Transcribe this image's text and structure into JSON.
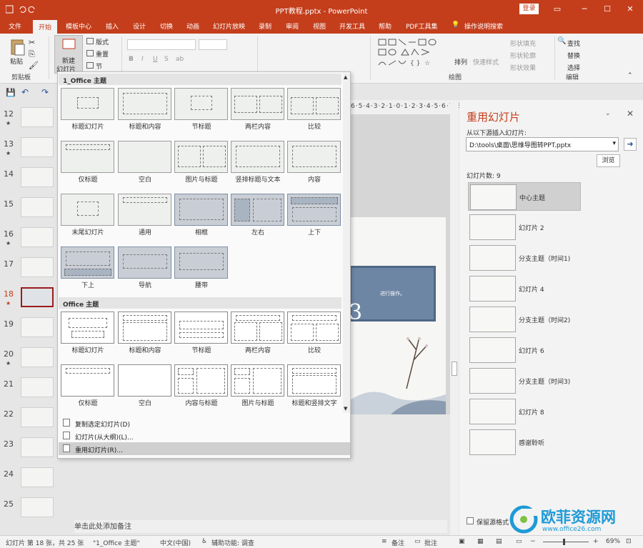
{
  "window": {
    "title": "PPT教程.pptx - PowerPoint",
    "login": "登录"
  },
  "tabs": [
    "文件",
    "开始",
    "模板中心",
    "插入",
    "设计",
    "切换",
    "动画",
    "幻灯片放映",
    "录制",
    "审阅",
    "视图",
    "开发工具",
    "帮助",
    "PDF工具集",
    "操作说明搜索"
  ],
  "ribbon": {
    "paste": "粘贴",
    "clipboard": "剪贴板",
    "new_slide_1": "新建",
    "new_slide_2": "幻灯片",
    "layout": "版式",
    "reset": "重置",
    "section": "节",
    "drawing": "绘图",
    "arrange": "排列",
    "quick_styles": "快速样式",
    "shape_fill": "形状填充",
    "shape_outline": "形状轮廓",
    "shape_effects": "形状效果",
    "find": "查找",
    "replace": "替换",
    "select": "选择",
    "editing": "编辑"
  },
  "slides": [
    {
      "num": "12",
      "star": "★"
    },
    {
      "num": "13",
      "star": "★"
    },
    {
      "num": "14",
      "star": ""
    },
    {
      "num": "15",
      "star": ""
    },
    {
      "num": "16",
      "star": "★"
    },
    {
      "num": "17",
      "star": ""
    },
    {
      "num": "18",
      "star": "★"
    },
    {
      "num": "19",
      "star": ""
    },
    {
      "num": "20",
      "star": "★"
    },
    {
      "num": "21",
      "star": ""
    },
    {
      "num": "22",
      "star": ""
    },
    {
      "num": "23",
      "star": ""
    },
    {
      "num": "24",
      "star": ""
    },
    {
      "num": "25",
      "star": ""
    }
  ],
  "layout_menu": {
    "section1": "1_Office 主题",
    "section1_layouts": [
      "标题幻灯片",
      "标题和内容",
      "节标题",
      "两栏内容",
      "比较",
      "仅标题",
      "空白",
      "图片与标题",
      "竖排标题与文本",
      "内容",
      "末尾幻灯片",
      "通用",
      "相框",
      "左右",
      "上下",
      "下上",
      "导航",
      "腰带"
    ],
    "section2": "Office 主题",
    "section2_layouts": [
      "标题幻灯片",
      "标题和内容",
      "节标题",
      "两栏内容",
      "比较",
      "仅标题",
      "空白",
      "内容与标题",
      "图片与标题",
      "标题和竖排文字"
    ],
    "commands": [
      "复制选定幻灯片(D)",
      "幻灯片(从大纲)(L)...",
      "重用幻灯片(R)..."
    ]
  },
  "ruler": "6·5·4·3·2·1·0·1·2·3·4·5·6·7·8·9·10·11·12·",
  "slide_text": "进行操作。",
  "slide_big": "3",
  "notes": "单击此处添加备注",
  "reuse_pane": {
    "title": "重用幻灯片",
    "insert_label": "从以下源插入幻灯片:",
    "path": "D:\\tools\\桌面\\思维导图转PPT.pptx",
    "browse": "浏览",
    "count_label": "幻灯片数: 9",
    "items": [
      "中心主题",
      "幻灯片 2",
      "分支主题（时间1)",
      "幻灯片 4",
      "分支主题（时间2)",
      "幻灯片 6",
      "分支主题（时间3)",
      "幻灯片 8",
      "感谢聆听"
    ],
    "keep_format": "保留源格式"
  },
  "status": {
    "slide_info": "幻灯片 第 18 张，共 25 张",
    "theme": "\"1_Office 主题\"",
    "lang": "中文(中国)",
    "access": "辅助功能: 调查",
    "notes_btn": "备注",
    "comments_btn": "批注",
    "zoom": "69%"
  },
  "watermark": {
    "brand": "欧菲资源网",
    "url": "www.office26.com"
  },
  "colors": {
    "accent": "#c43e1c",
    "selection": "#9a1c1c",
    "slide_blue": "#6d86a4"
  }
}
